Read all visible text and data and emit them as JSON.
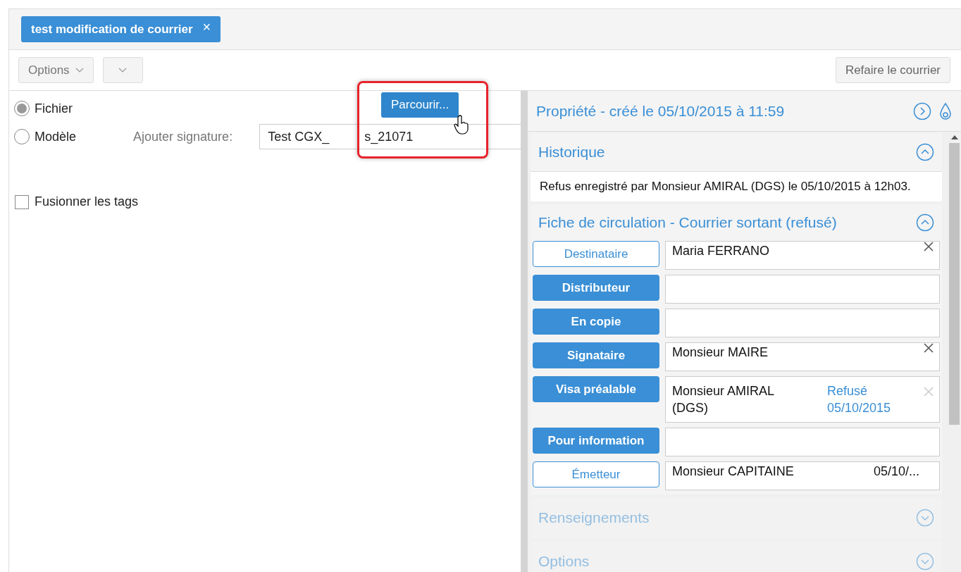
{
  "tab": {
    "label": "test modification de courrier",
    "close": "×"
  },
  "toolbar": {
    "options_label": "Options",
    "redo_button": "Refaire le courrier"
  },
  "source": {
    "options": [
      {
        "label": "Fichier",
        "selected": true
      },
      {
        "label": "Modèle",
        "selected": false
      }
    ],
    "browse_button": "Parcourir...",
    "browse_highlighted": true,
    "signature_label": "Ajouter signature:",
    "signature_value": "Test CGX_",
    "signature_value_tail": "s_21071",
    "merge_tags": {
      "label": "Fusionner les tags",
      "checked": false
    }
  },
  "properties": {
    "title": "Propriété - créé le 05/10/2015 à 11:59",
    "history": {
      "title": "Historique",
      "expanded": true,
      "text": "Refus enregistré par Monsieur AMIRAL (DGS) le 05/10/2015 à 12h03."
    },
    "circulation": {
      "title": "Fiche de circulation - Courrier sortant (refusé)",
      "expanded": true,
      "rows": [
        {
          "kind": "outline",
          "label": "Destinataire",
          "value": "Maria FERRANO",
          "clear": true,
          "clear_disabled": false
        },
        {
          "kind": "filled",
          "label": "Distributeur"
        },
        {
          "kind": "filled",
          "label": "En copie"
        },
        {
          "kind": "filled",
          "label": "Signataire",
          "value": "Monsieur MAIRE",
          "clear": true,
          "clear_disabled": false
        },
        {
          "kind": "filled",
          "label": "Visa préalable",
          "value": "Monsieur AMIRAL (DGS)",
          "status": "Refusé 05/10/2015",
          "clear": true,
          "clear_disabled": true
        },
        {
          "kind": "filled",
          "label": "Pour information"
        },
        {
          "kind": "outline",
          "label": "Émetteur",
          "value": "Monsieur CAPITAINE",
          "date": "05/10/..."
        }
      ]
    },
    "collapsed_sections": [
      {
        "title": "Renseignements",
        "expanded": false,
        "disabled": true
      },
      {
        "title": "Options",
        "expanded": false,
        "disabled": true
      }
    ]
  }
}
